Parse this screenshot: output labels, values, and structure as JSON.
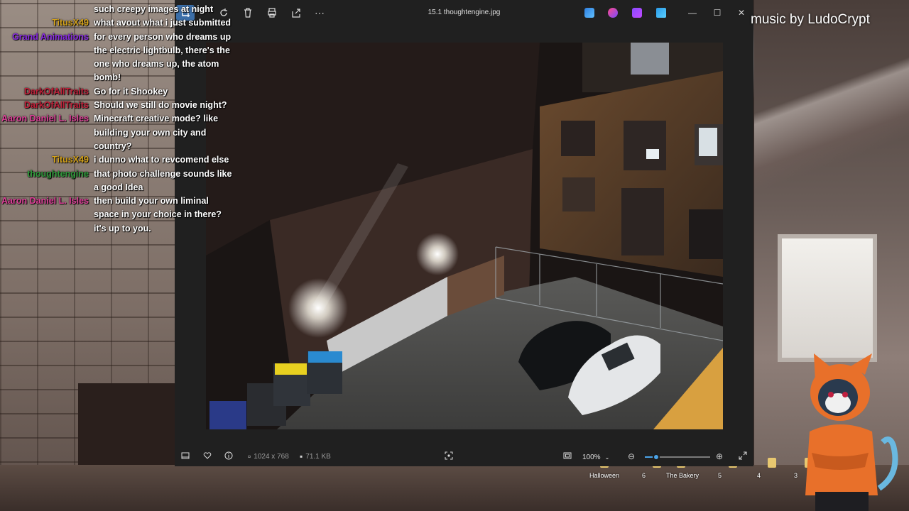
{
  "viewer": {
    "title": "15.1 thoughtengine.jpg",
    "image_info": {
      "dimensions": "1024 x 768",
      "file_size": "71.1 KB"
    },
    "zoom": {
      "level": "100%",
      "slider_fraction": 0.17
    }
  },
  "overlay": {
    "music_credit": "music by LudoCrypt"
  },
  "chat": [
    {
      "user": "",
      "color": "#ffffff",
      "text": "such creepy images at night"
    },
    {
      "user": "TitusX49",
      "color": "#d4a21a",
      "text": "what avout what i just submitted"
    },
    {
      "user": "Grand Animations",
      "color": "#8a2be2",
      "text": "for every person who dreams up the electric lightbulb, there's the one who dreams up, the atom bomb!"
    },
    {
      "user": "DarkOfAllTraits",
      "color": "#c0213a",
      "text": "Go for it Shookey"
    },
    {
      "user": "DarkOfAllTraits",
      "color": "#c0213a",
      "text": "Should we still do movie night?"
    },
    {
      "user": "Aaron Daniel L. Isles",
      "color": "#e0409a",
      "text": "Minecraft creative mode? like building your own city and country?"
    },
    {
      "user": "TitusX49",
      "color": "#d4a21a",
      "text": "i dunno what to revcomend else"
    },
    {
      "user": "thoughtengine",
      "color": "#2e9a3a",
      "text": "that photo challenge sounds like a good Idea"
    },
    {
      "user": "Aaron Daniel L. Isles",
      "color": "#e0409a",
      "text": "then build your own liminal space in your choice in there? it's up to you."
    }
  ],
  "taskbar": [
    {
      "label": "Halloween"
    },
    {
      "label": "6"
    },
    {
      "label": "The Bakery"
    },
    {
      "label": "5"
    },
    {
      "label": "4"
    },
    {
      "label": "3"
    }
  ]
}
